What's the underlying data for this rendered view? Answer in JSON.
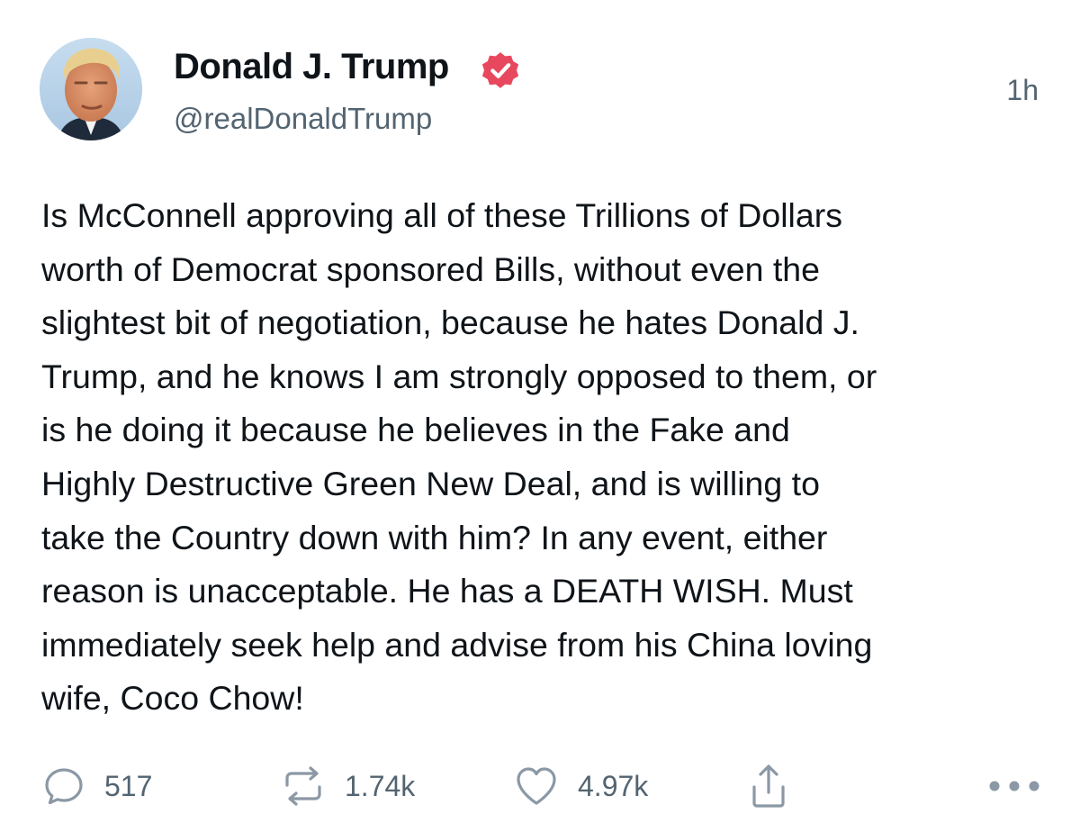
{
  "author": {
    "display_name": "Donald J. Trump",
    "handle": "@realDonaldTrump",
    "verified_color": "#e8485d"
  },
  "post": {
    "timestamp": "1h",
    "text": "Is McConnell approving all of these Trillions of Dollars\nworth of Democrat sponsored Bills, without even the\nslightest bit of negotiation, because he hates Donald J.\nTrump, and he knows I am strongly opposed to them, or\nis he doing it because he believes in the Fake and\nHighly Destructive Green New Deal, and is willing to\ntake the Country down with him? In any event, either\nreason is unacceptable. He has a DEATH WISH. Must\nimmediately seek help and advise from his China loving\nwife, Coco Chow!"
  },
  "actions": {
    "replies": "517",
    "reposts": "1.74k",
    "likes": "4.97k",
    "share_icon": "share-icon",
    "more_icon": "more-icon"
  },
  "colors": {
    "text": "#0f1419",
    "muted": "#536471",
    "icon": "#8b98a5"
  }
}
